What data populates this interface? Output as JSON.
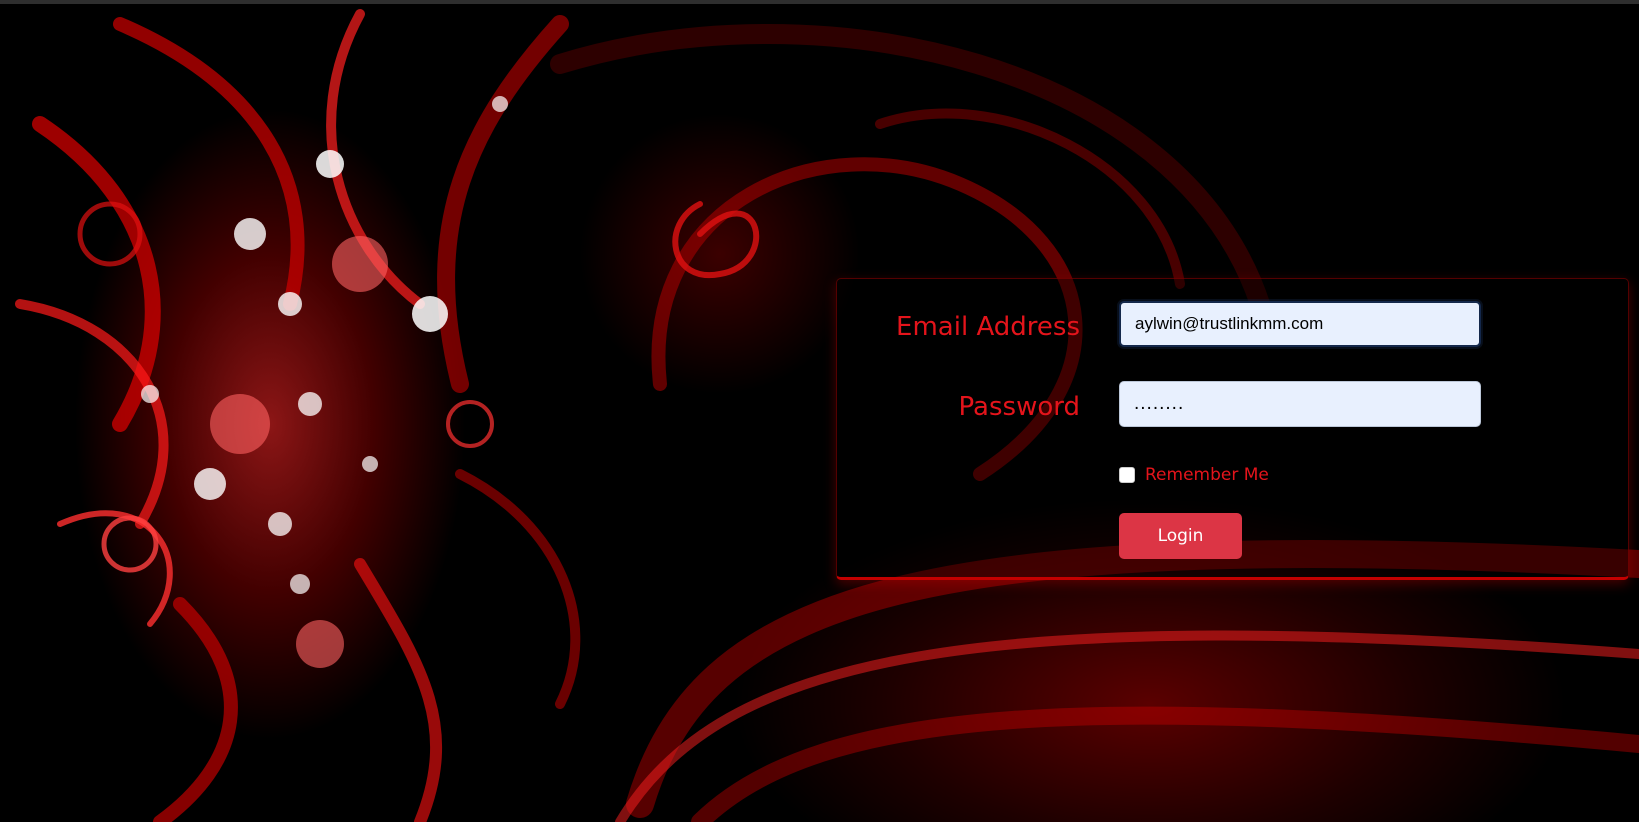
{
  "colors": {
    "label": "#e4141b",
    "button": "#dc3545",
    "input_bg": "#e8f0fe",
    "panel_border": "#c40000",
    "background": "#000000"
  },
  "background": {
    "icon": "red-fractal-swirl"
  },
  "login_form": {
    "email_label": "Email Address",
    "email_value": "aylwin@trustlinkmm.com",
    "password_label": "Password",
    "password_value": "........",
    "remember_label": "Remember Me",
    "remember_checked": false,
    "login_button": "Login"
  }
}
